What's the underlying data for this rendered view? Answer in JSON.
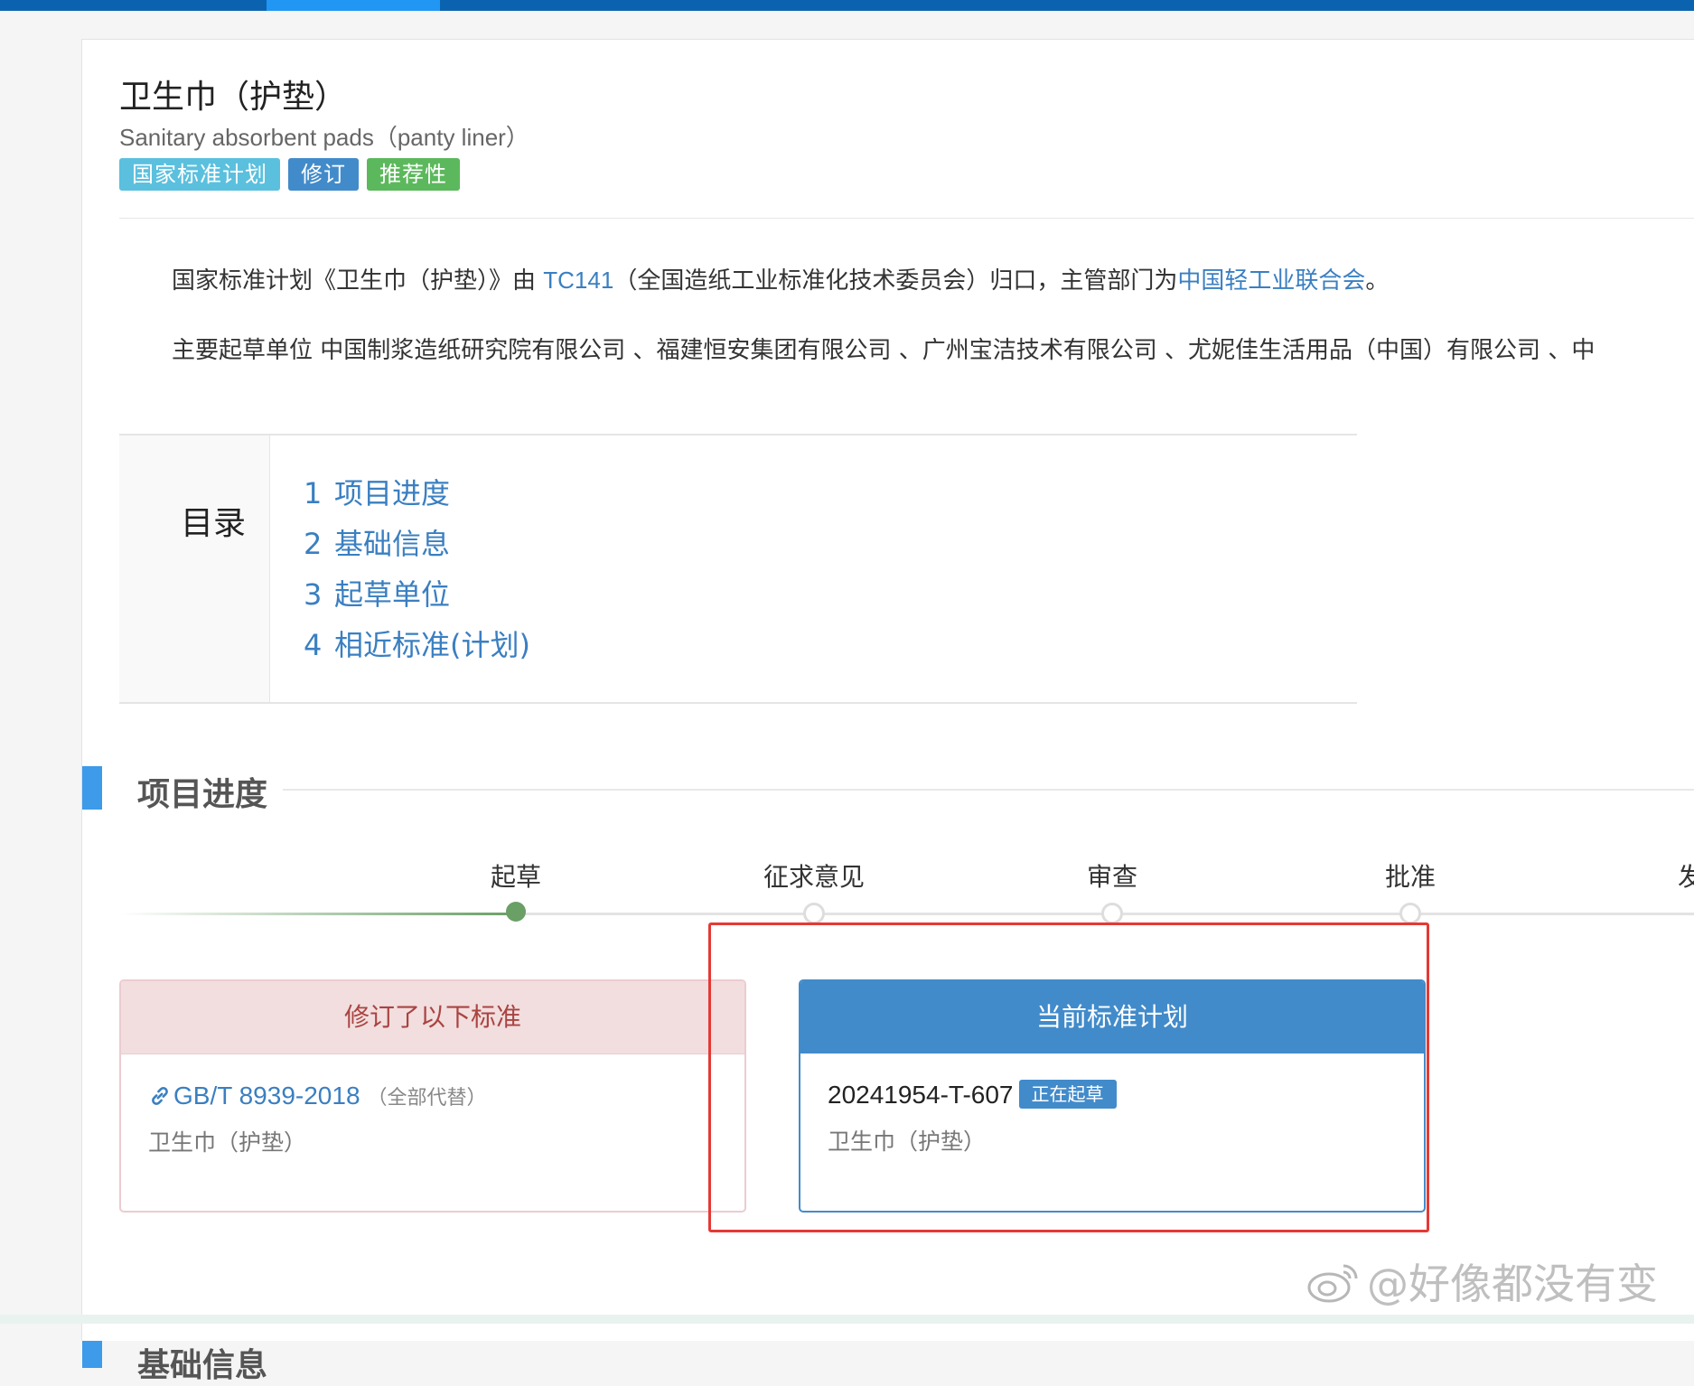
{
  "header": {
    "title": "卫生巾（护垫）",
    "subtitle": "Sanitary absorbent pads（panty liner）"
  },
  "badges": {
    "plan": "国家标准计划",
    "revision": "修订",
    "recommended": "推荐性"
  },
  "intro": {
    "p1_prefix": "国家标准计划《卫生巾（护垫）》由 ",
    "p1_tc": "TC141",
    "p1_mid": "（全国造纸工业标准化技术委员会）归口，主管部门为",
    "p1_dept": "中国轻工业联合会",
    "p1_end": "。",
    "p2": "主要起草单位 中国制浆造纸研究院有限公司 、福建恒安集团有限公司 、广州宝洁技术有限公司 、尤妮佳生活用品（中国）有限公司 、中"
  },
  "toc": {
    "label": "目录",
    "items": [
      {
        "num": "1",
        "label": "项目进度"
      },
      {
        "num": "2",
        "label": "基础信息"
      },
      {
        "num": "3",
        "label": "起草单位"
      },
      {
        "num": "4",
        "label": "相近标准(计划)"
      }
    ]
  },
  "progress": {
    "section_title": "项目进度",
    "steps": [
      "起草",
      "征求意见",
      "审查",
      "批准",
      "发"
    ],
    "current_step": 1
  },
  "revised_card": {
    "title": "修订了以下标准",
    "code": "GB/T 8939-2018",
    "note": "（全部代替）",
    "name": "卫生巾（护垫）"
  },
  "current_card": {
    "title": "当前标准计划",
    "code": "20241954-T-607",
    "status": "正在起草",
    "name": "卫生巾（护垫）"
  },
  "next_section": {
    "title": "基础信息"
  },
  "watermark": "@好像都没有变",
  "colors": {
    "link": "#3a7fc1",
    "primary": "#428bca",
    "done": "#6a9f66",
    "highlight": "#e53935"
  }
}
